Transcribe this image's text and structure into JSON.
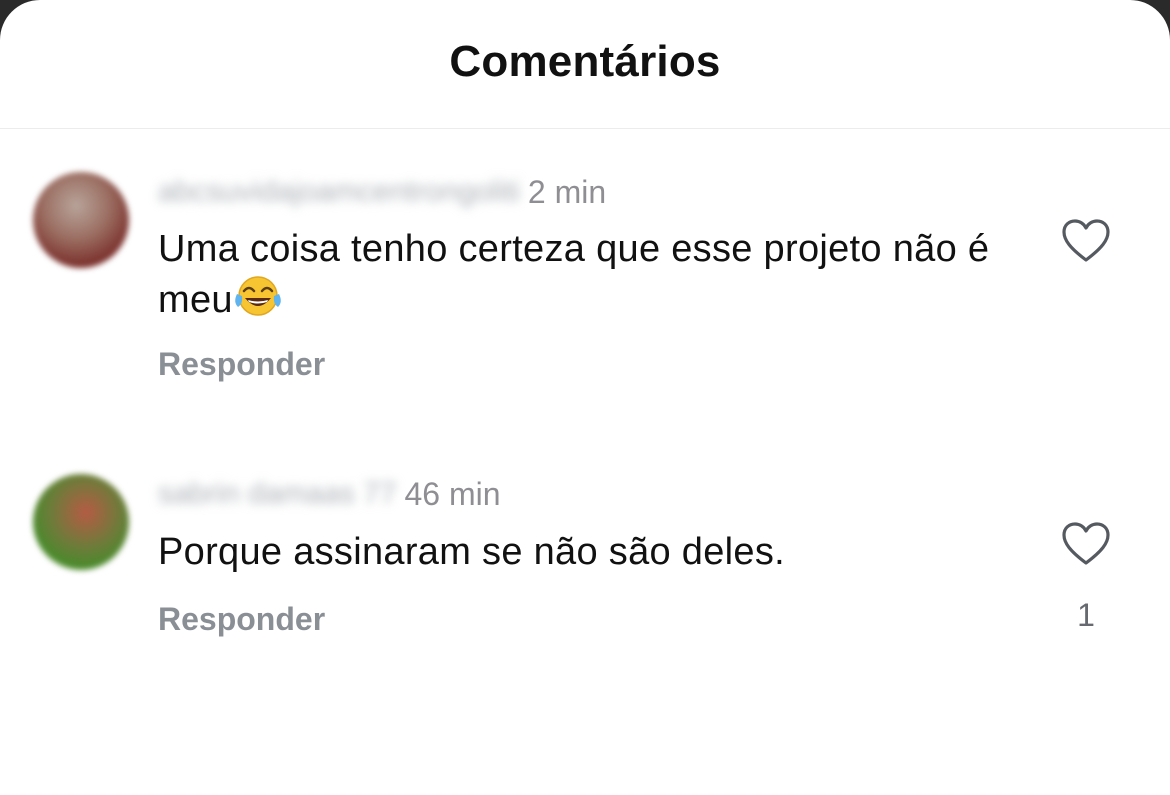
{
  "header": {
    "title": "Comentários"
  },
  "comments": [
    {
      "username": "abcsuvidajoamcentrongoliti",
      "time": "2 min",
      "text_before_emoji": "Uma coisa tenho certeza que esse projeto não é meu",
      "emoji": "face-with-tears-of-joy",
      "reply_label": "Responder",
      "like_icon": "heart-outline-icon",
      "like_count": ""
    },
    {
      "username": "sabrin damaas 77",
      "time": "46 min",
      "text_before_emoji": "Porque assinaram se não são deles.",
      "reply_label": "Responder",
      "like_icon": "heart-outline-icon",
      "like_count": "1"
    }
  ],
  "colors": {
    "background": "#ffffff",
    "primary_text": "#111111",
    "secondary_text": "#8e8e93",
    "reply_text": "#8a8f96"
  }
}
